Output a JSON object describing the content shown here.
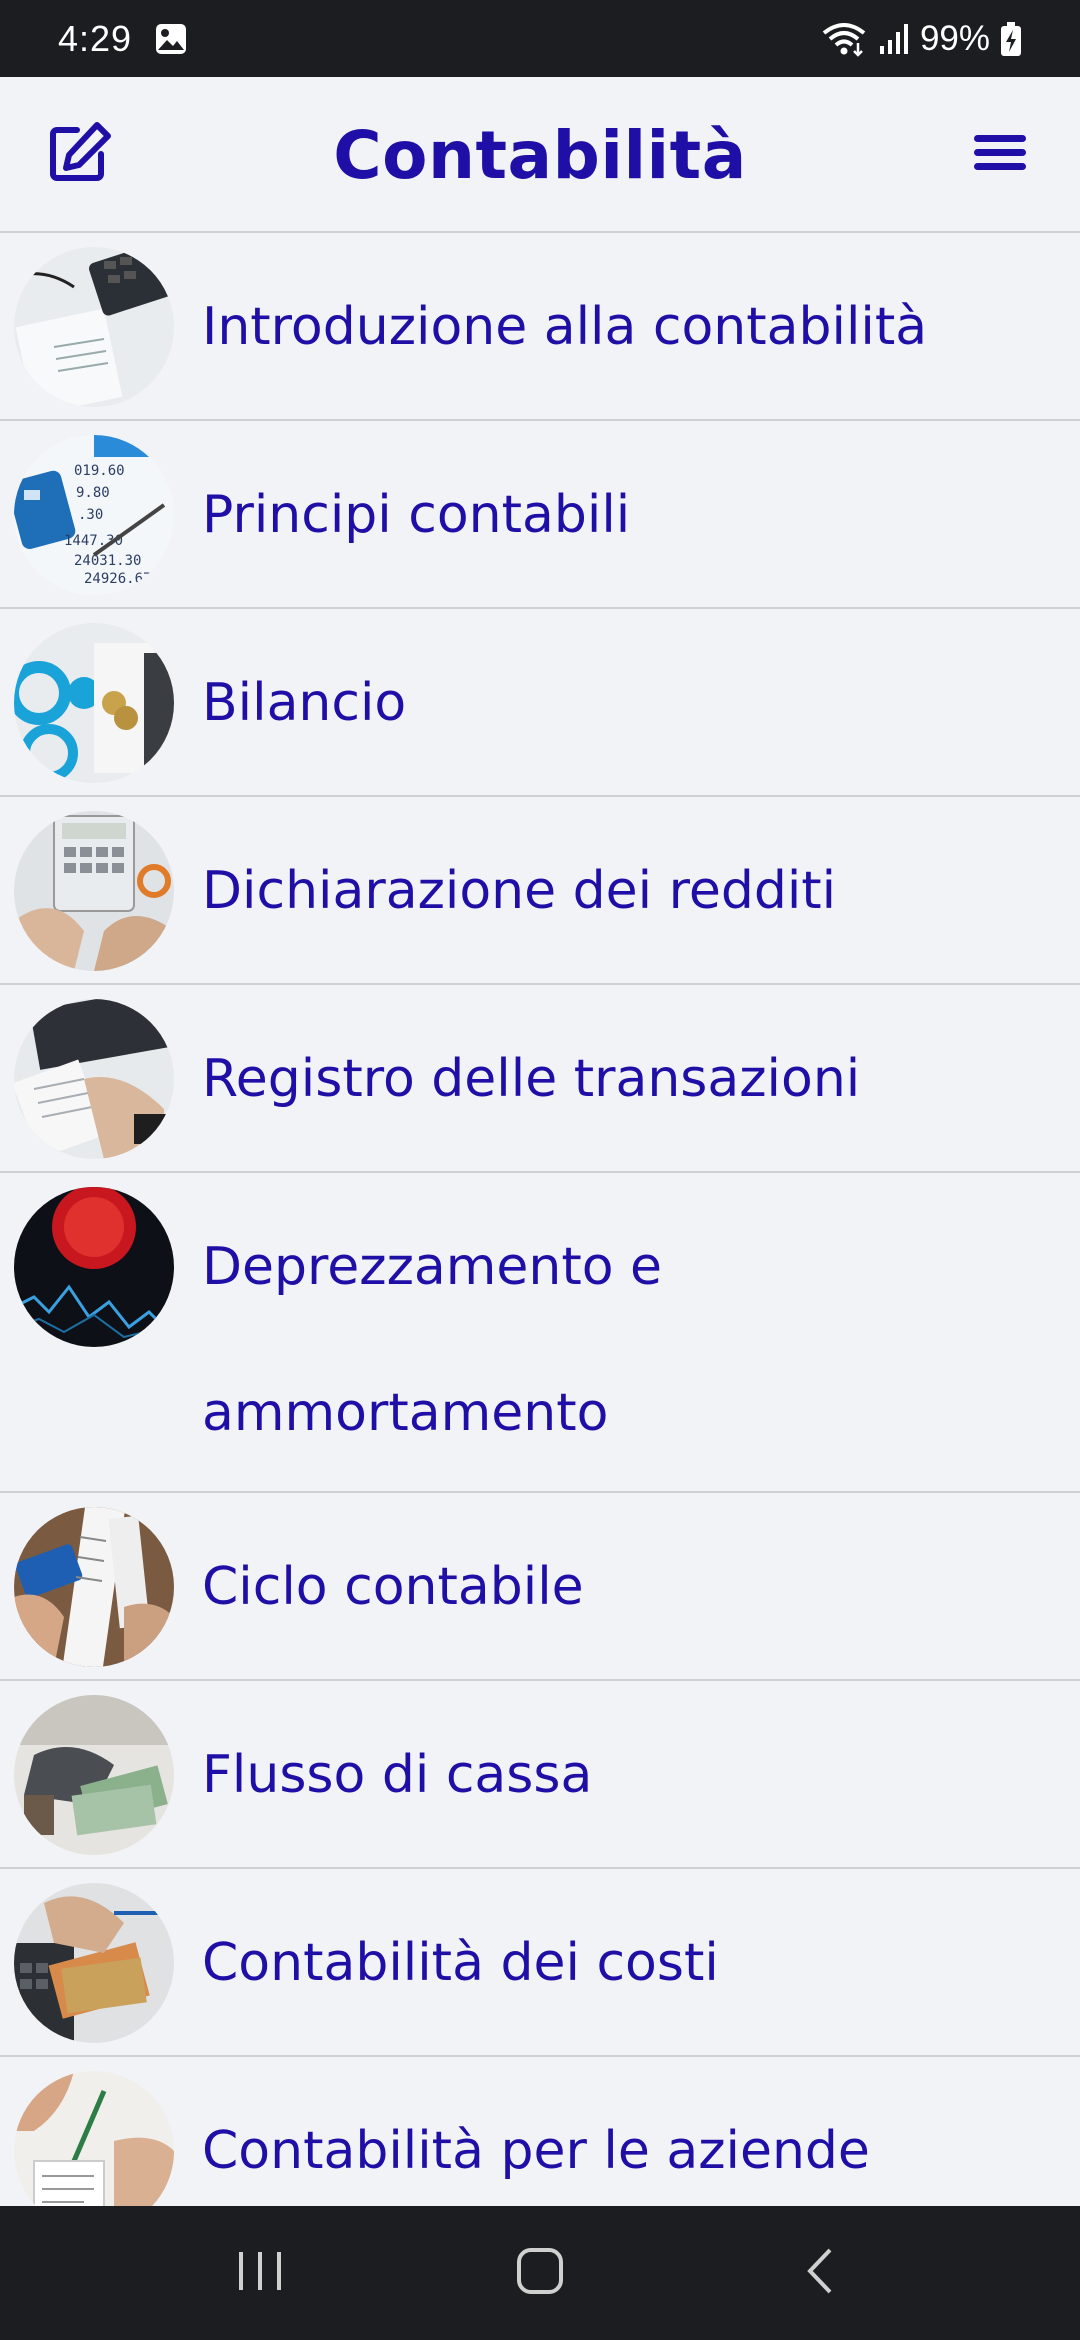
{
  "status_bar": {
    "time": "4:29",
    "battery": "99%",
    "icons": [
      "gallery-icon",
      "wifi-icon",
      "signal-icon",
      "battery-charging-icon"
    ]
  },
  "header": {
    "title": "Contabilità",
    "left_icon": "edit-icon",
    "right_icon": "menu-icon"
  },
  "topics": [
    {
      "label": "Introduzione alla contabilità",
      "thumb": "calculator-papers"
    },
    {
      "label": "Principi contabili",
      "thumb": "balance-sheet-numbers"
    },
    {
      "label": "Bilancio",
      "thumb": "charts-coins"
    },
    {
      "label": "Dichiarazione dei redditi",
      "thumb": "hands-calculator"
    },
    {
      "label": "Registro delle transazioni",
      "thumb": "laptop-receipts"
    },
    {
      "label": "Deprezzamento e ammortamento",
      "thumb": "red-stock-chart"
    },
    {
      "label": "Ciclo contabile",
      "thumb": "cards-receipts"
    },
    {
      "label": "Flusso di cassa",
      "thumb": "money-desk"
    },
    {
      "label": "Contabilità dei costi",
      "thumb": "cash-calculator"
    },
    {
      "label": "Contabilità per le aziende",
      "thumb": "hands-pen"
    }
  ],
  "colors": {
    "accent": "#1f0fa6",
    "background": "#f2f3f6",
    "bars": "#1c1d21"
  }
}
